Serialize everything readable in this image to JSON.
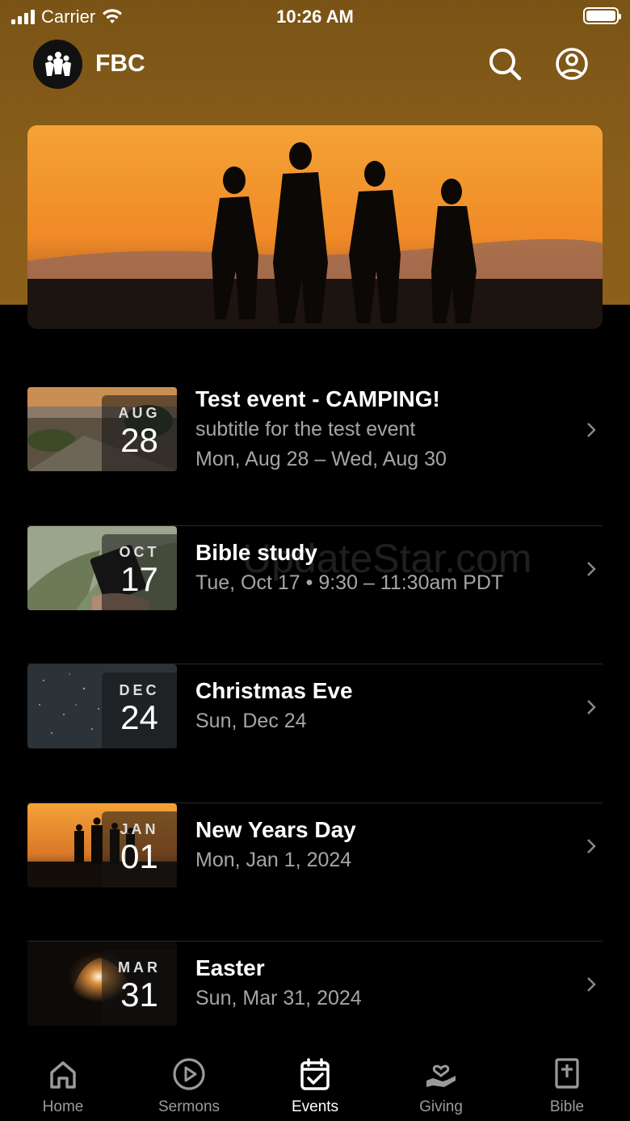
{
  "status_bar": {
    "carrier": "Carrier",
    "time": "10:26 AM"
  },
  "header": {
    "title": "FBC",
    "logo_icon": "church-logo-icon",
    "search_icon": "search-icon",
    "profile_icon": "profile-icon"
  },
  "events": [
    {
      "month": "AUG",
      "day": "28",
      "title": "Test event - CAMPING!",
      "subtitle": "subtitle for the test event",
      "date": "Mon, Aug 28 – Wed, Aug 30"
    },
    {
      "month": "OCT",
      "day": "17",
      "title": "Bible study",
      "date": "Tue, Oct 17 • 9:30 – 11:30am PDT"
    },
    {
      "month": "DEC",
      "day": "24",
      "title": "Christmas Eve",
      "date": "Sun, Dec 24"
    },
    {
      "month": "JAN",
      "day": "01",
      "title": "New Years Day",
      "date": "Mon, Jan 1, 2024"
    },
    {
      "month": "MAR",
      "day": "31",
      "title": "Easter",
      "date": "Sun, Mar 31, 2024"
    }
  ],
  "watermark": "UpdateStar.com",
  "tabs": [
    {
      "label": "Home",
      "icon": "home-icon",
      "active": false
    },
    {
      "label": "Sermons",
      "icon": "play-icon",
      "active": false
    },
    {
      "label": "Events",
      "icon": "calendar-check-icon",
      "active": true
    },
    {
      "label": "Giving",
      "icon": "giving-hand-icon",
      "active": false
    },
    {
      "label": "Bible",
      "icon": "bible-icon",
      "active": false
    }
  ],
  "colors": {
    "header_bg": "#8a5e1a",
    "background": "#000000",
    "active_tab": "#ffffff",
    "inactive_tab": "#9a9a9a"
  }
}
